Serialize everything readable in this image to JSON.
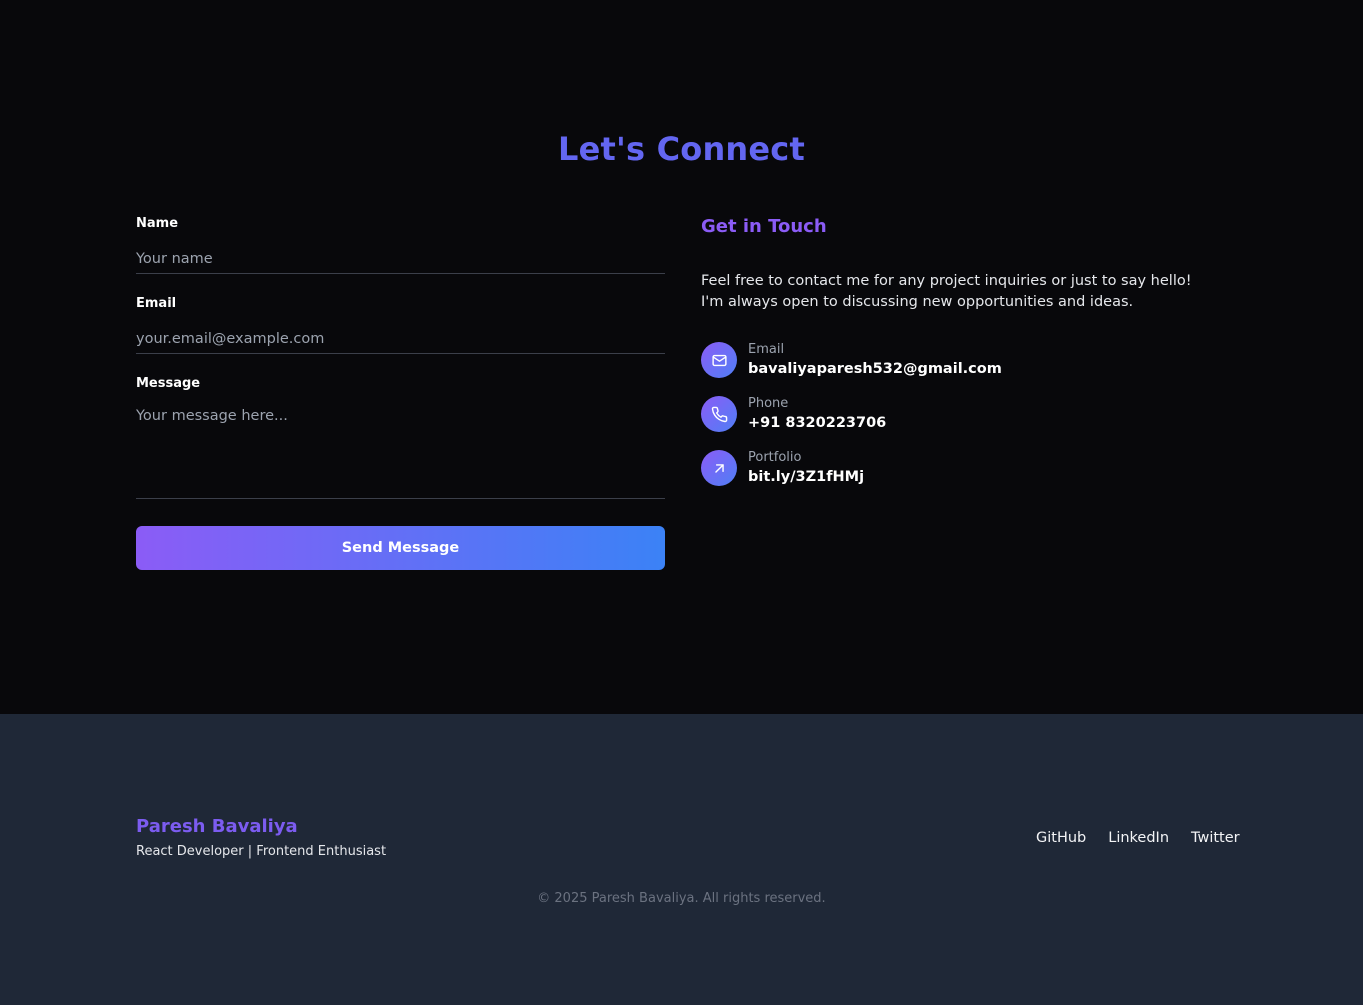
{
  "contact": {
    "title": "Let's Connect",
    "form": {
      "name_label": "Name",
      "name_placeholder": "Your name",
      "email_label": "Email",
      "email_placeholder": "your.email@example.com",
      "message_label": "Message",
      "message_placeholder": "Your message here...",
      "submit_label": "Send Message"
    },
    "info": {
      "heading": "Get in Touch",
      "description": "Feel free to contact me for any project inquiries or just to say hello! I'm always open to discussing new opportunities and ideas.",
      "items": [
        {
          "label": "Email",
          "value": "bavaliyaparesh532@gmail.com",
          "icon": "mail-icon"
        },
        {
          "label": "Phone",
          "value": "+91 8320223706",
          "icon": "phone-icon"
        },
        {
          "label": "Portfolio",
          "value": "bit.ly/3Z1fHMj",
          "icon": "arrow-up-right-icon"
        }
      ]
    }
  },
  "footer": {
    "brand": "Paresh Bavaliya",
    "tagline": "React Developer | Frontend Enthusiast",
    "links": [
      "GitHub",
      "LinkedIn",
      "Twitter"
    ],
    "copyright": "© 2025 Paresh Bavaliya. All rights reserved."
  },
  "colors": {
    "background": "#08080b",
    "footer_background": "#1f2837",
    "accent": "#6366f1",
    "accent_purple": "#8b5cf6",
    "accent_blue": "#3b82f6"
  }
}
